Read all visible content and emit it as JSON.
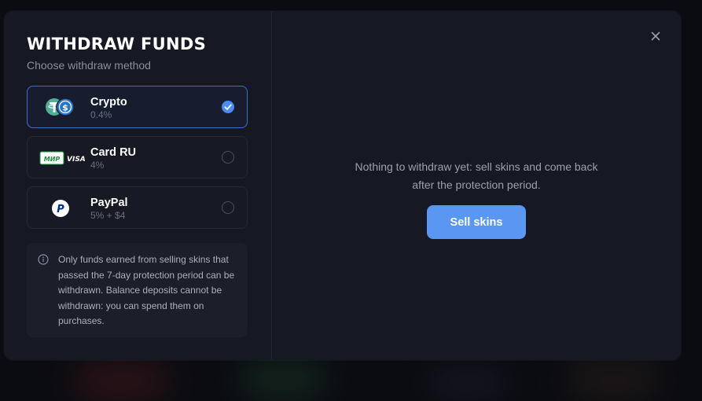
{
  "dialog": {
    "title": "WITHDRAW FUNDS",
    "subtitle": "Choose withdraw method"
  },
  "methods": [
    {
      "name": "Crypto",
      "fee": "0.4%",
      "selected": true,
      "icon": "tether-usdc-icon",
      "colors": {
        "tether": "#50af95",
        "usdc": "#2775ca"
      }
    },
    {
      "name": "Card RU",
      "fee": "4%",
      "selected": false,
      "icon": "mir-visa-icon",
      "logos": {
        "mir": "МИР",
        "visa": "VISA"
      },
      "colors": {
        "mir": "#1b8f3c"
      }
    },
    {
      "name": "PayPal",
      "fee": "5% + $4",
      "selected": false,
      "icon": "paypal-icon",
      "logos": {
        "paypal": "P"
      },
      "colors": {
        "paypal": "#003087"
      }
    }
  ],
  "info": {
    "icon": "info-circle-icon",
    "text": "Only funds earned from selling skins that passed the 7-day protection period can be withdrawn. Balance deposits cannot be withdrawn: you can spend them on purchases."
  },
  "right_panel": {
    "message_line1": "Nothing to withdraw yet: sell skins and come back",
    "message_line2": "after the protection period.",
    "sell_button": "Sell skins",
    "close_icon": "close-icon"
  },
  "colors": {
    "accent": "#4a8cf5",
    "button": "#5a97f2",
    "panel": "#161923",
    "selected_border": "#3f6fd0"
  }
}
